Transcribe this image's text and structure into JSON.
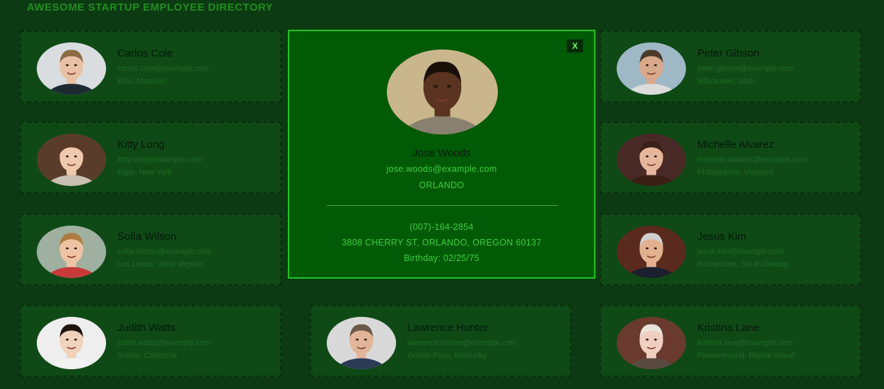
{
  "header": {
    "title": "AWESOME STARTUP EMPLOYEE DIRECTORY"
  },
  "employees": [
    {
      "name": "Carlos Cole",
      "email": "carlos.cole@example.com",
      "location": "Elko, Missouri",
      "skin": "#e8c1a6",
      "hair": "#8b6a45",
      "shirt": "#1d2a33",
      "bg": "#d9dde0"
    },
    {
      "name": "Peter Gibson",
      "email": "peter.gibson@example.com",
      "location": "Milwaukee, Utah",
      "skin": "#d7a98a",
      "hair": "#4b3a2a",
      "shirt": "#dcdcdc",
      "bg": "#9fb8c6"
    },
    {
      "name": "Kitty Long",
      "email": "kitty.long@example.com",
      "location": "Elgin, New York",
      "skin": "#efc9ae",
      "hair": "#5a3a24",
      "shirt": "#c8c0b2",
      "bg": "#5a3c2a"
    },
    {
      "name": "Michelle Alvarez",
      "email": "michelle.alvarez@example.com",
      "location": "Philadelphia, Vermont",
      "skin": "#e5b59c",
      "hair": "#3a1f15",
      "shirt": "#3a1f15",
      "bg": "#4a2a26"
    },
    {
      "name": "Sofia Wilson",
      "email": "sofia.wilson@example.com",
      "location": "Los Lunas, West Virginia",
      "skin": "#efc4a5",
      "hair": "#b07a3e",
      "shirt": "#c83a3a",
      "bg": "#9fb0a0"
    },
    {
      "name": "Jesus Kim",
      "email": "jesus.kim@example.com",
      "location": "Richardson, South Dakota",
      "skin": "#e3b090",
      "hair": "#cfcfcf",
      "shirt": "#1c1f2e",
      "bg": "#5a2a1e"
    },
    {
      "name": "Judith Watts",
      "email": "judith.watts@example.com",
      "location": "Scurry, California",
      "skin": "#f1d2bb",
      "hair": "#1d1410",
      "shirt": "#f2f2f2",
      "bg": "#eeeeee"
    },
    {
      "name": "Lawrence Hunter",
      "email": "lawrence.hunter@example.com",
      "location": "Grants Pass, Kentucky",
      "skin": "#e2b59a",
      "hair": "#6b5a48",
      "shirt": "#2c3b55",
      "bg": "#d9d9d9"
    },
    {
      "name": "Kristina Lane",
      "email": "kristina.lane@example.com",
      "location": "Flowermound, Rhode Island",
      "skin": "#f0cfc0",
      "hair": "#e8e4d8",
      "shirt": "#5a4a40",
      "bg": "#6a3a2e"
    }
  ],
  "modal": {
    "name": "Jose Woods",
    "email": "jose.woods@example.com",
    "city": "ORLANDO",
    "phone": "(007)-164-2854",
    "address": "3808 CHERRY ST, ORLANDO, OREGON 60137",
    "birthday": "Birthday: 02/25/75",
    "close_label": "X",
    "skin": "#5a3420",
    "hair": "#1a0f08",
    "shirt": "#8a8070",
    "bg": "#c9b68c"
  },
  "colors": {
    "accent": "#22c322",
    "page_bg": "#0c3a12",
    "card_bg": "#0f4a16"
  }
}
